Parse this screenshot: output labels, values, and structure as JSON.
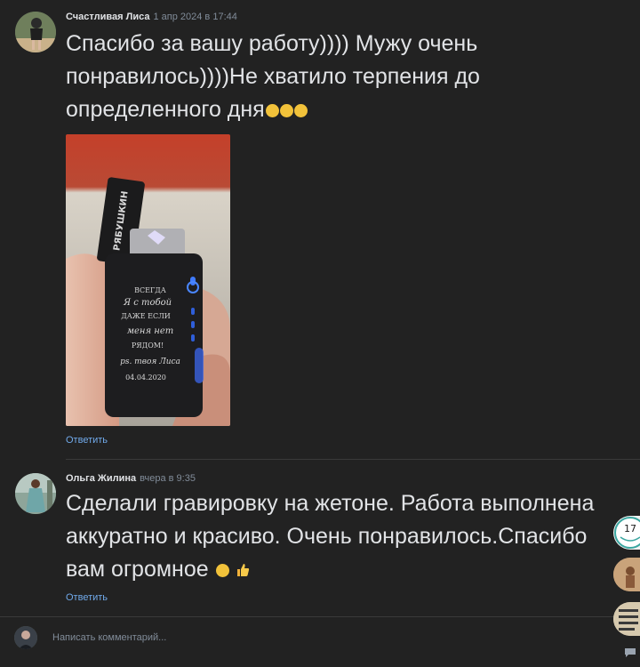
{
  "comments": [
    {
      "author": "Счастливая Лиса",
      "date": "1 апр 2024 в 17:44",
      "text": "Спасибо за вашу работу)))) Мужу очень понравилось))))Не хватило терпения до определенного дня",
      "emoji": [
        "rolling-laughing-emoji",
        "rolling-laughing-emoji",
        "rolling-laughing-emoji"
      ],
      "reply_label": "Ответить",
      "photo": {
        "lid_text": "РЯБУШКИН",
        "engraving": [
          "ВСЕГДА",
          "Я с тобой",
          "ДАЖЕ ЕСЛИ",
          "меня нет",
          "РЯДОМ!",
          "ps. твоя Лиса",
          "04.04.2020"
        ]
      }
    },
    {
      "author": "Ольга Жилина",
      "date": "вчера в 9:35",
      "text": "Сделали гравировку на жетоне. Работа выполнена аккуратно и красиво. Очень понравилось.Спасибо вам огромное",
      "emoji": [
        "smile-emoji",
        "thumbs-up-emoji"
      ],
      "reply_label": "Ответить"
    }
  ],
  "side_rail": {
    "badge": "17"
  },
  "composer": {
    "placeholder": "Написать комментарий..."
  },
  "colors": {
    "background": "#222222",
    "text": "#e1e3e6",
    "meta": "#818c99",
    "link": "#71aaeb"
  }
}
